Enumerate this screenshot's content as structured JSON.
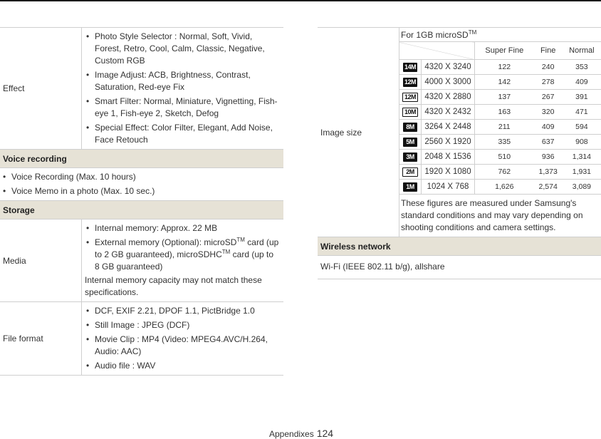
{
  "left": {
    "effect": {
      "label": "Effect",
      "items": [
        "Photo Style Selector : Normal, Soft, Vivid, Forest, Retro, Cool, Calm, Classic, Negative, Custom RGB",
        "Image Adjust: ACB, Brightness, Contrast, Saturation, Red-eye Fix",
        "Smart Filter: Normal, Miniature, Vignetting, Fish-eye 1, Fish-eye 2, Sketch, Defog",
        "Special Effect: Color Filter, Elegant, Add Noise, Face Retouch"
      ]
    },
    "voice": {
      "title": "Voice recording",
      "items": [
        "Voice Recording (Max. 10 hours)",
        "Voice Memo in a photo (Max. 10 sec.)"
      ]
    },
    "storage": {
      "title": "Storage",
      "media_label": "Media",
      "internal": "Internal memory: Approx. 22 MB",
      "external_a": "External memory (Optional): microSD",
      "tm": "TM",
      "external_b": " card (up to 2 GB guaranteed), microSDHC",
      "external_c": " card (up to 8 GB guaranteed)",
      "note": "Internal memory capacity may not match these specifications.",
      "format_label": "File format",
      "format_items": [
        "DCF, EXIF 2.21, DPOF 1.1, PictBridge 1.0",
        "Still Image : JPEG (DCF)",
        "Movie Clip : MP4 (Video: MPEG4.AVC/H.264, Audio: AAC)",
        "Audio file : WAV"
      ]
    }
  },
  "right": {
    "image_size": {
      "label": "Image size",
      "header": "For 1GB microSD",
      "header_tm": "TM",
      "columns": [
        "Super Fine",
        "Fine",
        "Normal"
      ],
      "rows": [
        {
          "icon": "14M",
          "style": "solid",
          "res": "4320 X 3240",
          "vals": [
            "122",
            "240",
            "353"
          ]
        },
        {
          "icon": "12M",
          "style": "solid",
          "res": "4000 X 3000",
          "vals": [
            "142",
            "278",
            "409"
          ]
        },
        {
          "icon": "12M",
          "style": "outline",
          "res": "4320 X 2880",
          "vals": [
            "137",
            "267",
            "391"
          ]
        },
        {
          "icon": "10M",
          "style": "outline",
          "res": "4320 X 2432",
          "vals": [
            "163",
            "320",
            "471"
          ]
        },
        {
          "icon": "8M",
          "style": "solid",
          "res": "3264 X 2448",
          "vals": [
            "211",
            "409",
            "594"
          ]
        },
        {
          "icon": "5M",
          "style": "solid",
          "res": "2560 X 1920",
          "vals": [
            "335",
            "637",
            "908"
          ]
        },
        {
          "icon": "3M",
          "style": "solid",
          "res": "2048 X 1536",
          "vals": [
            "510",
            "936",
            "1,314"
          ]
        },
        {
          "icon": "2M",
          "style": "outline",
          "res": "1920 X 1080",
          "vals": [
            "762",
            "1,373",
            "1,931"
          ]
        },
        {
          "icon": "1M",
          "style": "solid",
          "res": "1024 X 768",
          "vals": [
            "1,626",
            "2,574",
            "3,089"
          ]
        }
      ],
      "note": "These figures are measured under Samsung's standard conditions and may vary depending on shooting conditions and camera settings."
    },
    "wireless": {
      "title": "Wireless network",
      "text": "Wi-Fi (IEEE 802.11 b/g), allshare"
    }
  },
  "footer": {
    "section": "Appendixes",
    "page": "124"
  }
}
